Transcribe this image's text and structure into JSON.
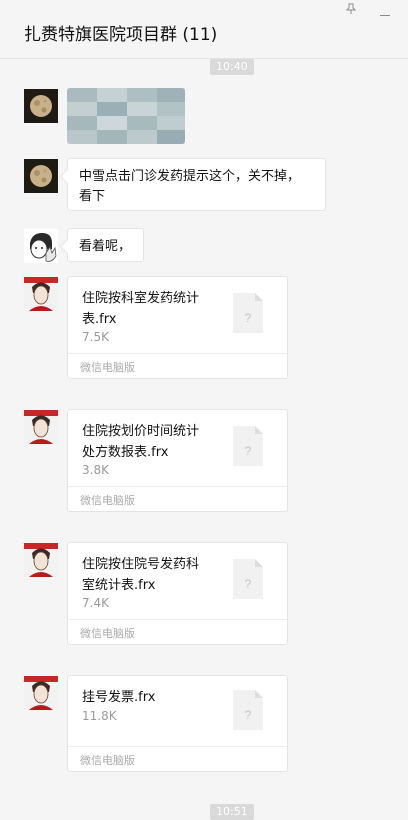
{
  "window": {
    "title": "扎赉特旗医院项目群 (11)",
    "pin_icon": "pin-icon",
    "minimize_icon": "minimize-icon"
  },
  "timestamps": [
    "10:40",
    "10:51"
  ],
  "messages": [
    {
      "type": "image",
      "sender_avatar": "moon-avatar"
    },
    {
      "type": "text",
      "sender_avatar": "moon-avatar",
      "text_line1": "中雪点击门诊发药提示这个，关不掉，",
      "text_line2": "看下"
    },
    {
      "type": "text",
      "sender_avatar": "cartoon-avatar",
      "text": "看着呢，"
    },
    {
      "type": "file",
      "sender_avatar": "portrait-avatar",
      "name_line1": "住院按科室发药统计",
      "name_line2": "表.frx",
      "size": "7.5K",
      "source": "微信电脑版"
    },
    {
      "type": "file",
      "sender_avatar": "portrait-avatar",
      "name_line1": "住院按划价时间统计",
      "name_line2": "处方数报表.frx",
      "size": "3.8K",
      "source": "微信电脑版"
    },
    {
      "type": "file",
      "sender_avatar": "portrait-avatar",
      "name_line1": "住院按住院号发药科",
      "name_line2": "室统计表.frx",
      "size": "7.4K",
      "source": "微信电脑版"
    },
    {
      "type": "file",
      "sender_avatar": "portrait-avatar",
      "name_line1": "挂号发票.frx",
      "size": "11.8K",
      "source": "微信电脑版"
    }
  ]
}
